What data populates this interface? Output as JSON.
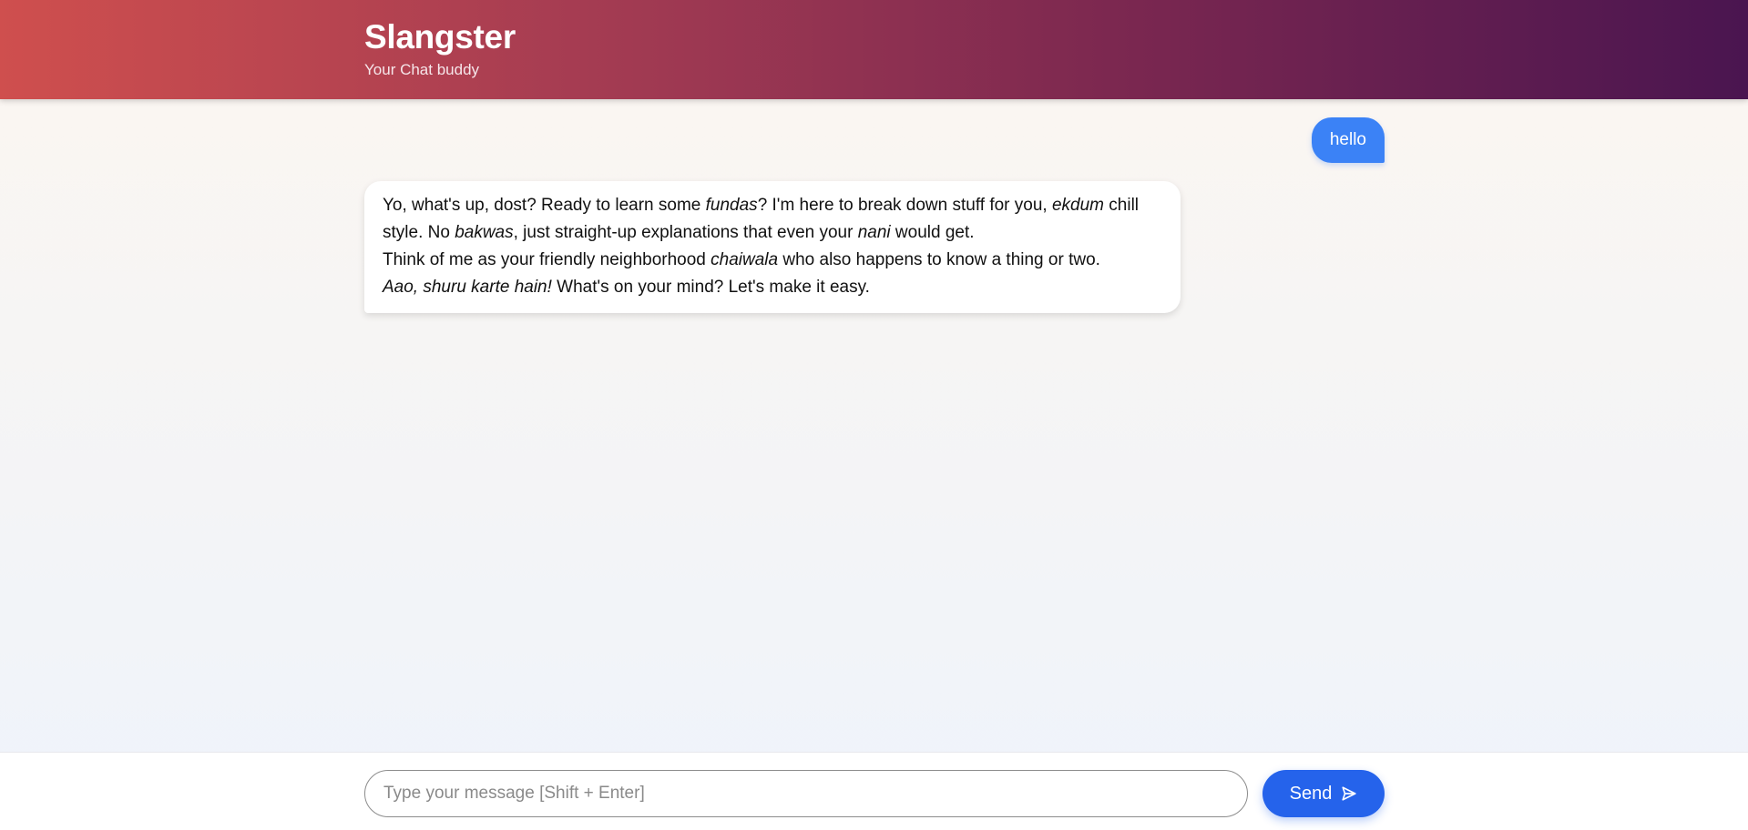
{
  "header": {
    "title": "Slangster",
    "subtitle": "Your Chat buddy"
  },
  "messages": {
    "user": {
      "text": "hello"
    },
    "bot": {
      "line1": {
        "t1": "Yo, what's up, dost? Ready to learn some ",
        "e1": "fundas",
        "t2": "? I'm here to break down stuff for you, ",
        "e2": "ekdum",
        "t3": " chill style. No ",
        "e3": "bakwas",
        "t4": ", just straight-up explanations that even your ",
        "e4": "nani",
        "t5": " would get."
      },
      "line2": {
        "t1": "Think of me as your friendly neighborhood ",
        "e1": "chaiwala",
        "t2": " who also happens to know a thing or two."
      },
      "line3": {
        "e1": "Aao, shuru karte hain!",
        "t1": " What's on your mind? Let's make it easy."
      }
    }
  },
  "composer": {
    "placeholder": "Type your message [Shift + Enter]",
    "value": "",
    "send_label": "Send",
    "send_icon": "send-arrow-icon"
  },
  "colors": {
    "header_gradient_start": "#cf4f4e",
    "header_gradient_end": "#4a1550",
    "user_bubble": "#3b82f6",
    "send_button": "#2563eb"
  }
}
